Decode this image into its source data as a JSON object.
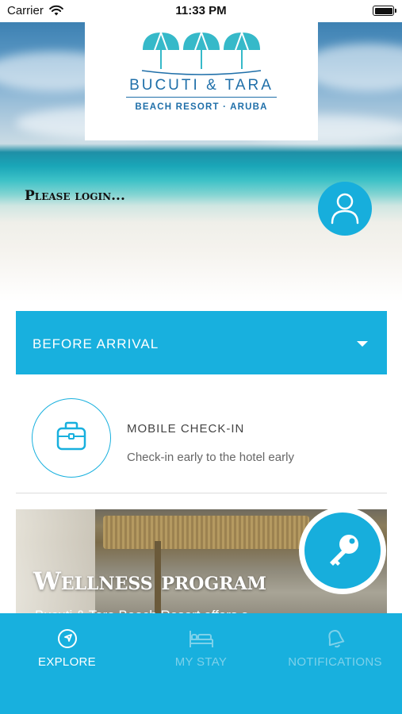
{
  "status_bar": {
    "carrier": "Carrier",
    "time": "11:33 PM"
  },
  "logo": {
    "name": "BUCUTI & TARA",
    "subtitle": "BEACH RESORT · ARUBA"
  },
  "hero": {
    "login_prompt": "Please login..."
  },
  "dropdown": {
    "label": "BEFORE ARRIVAL"
  },
  "checkin": {
    "title": "MOBILE CHECK-IN",
    "subtitle": "Check-in early to the hotel early"
  },
  "wellness": {
    "title": "Wellness program",
    "subtitle": "Bucuti & Tara Beach Resort offers a"
  },
  "tabs": [
    {
      "label": "EXPLORE",
      "icon": "compass-icon",
      "active": true
    },
    {
      "label": "MY STAY",
      "icon": "bed-icon",
      "active": false
    },
    {
      "label": "NOTIFICATIONS",
      "icon": "bell-icon",
      "active": false
    }
  ],
  "colors": {
    "accent": "#18b0de",
    "tab_inactive": "#7dd1ea"
  }
}
